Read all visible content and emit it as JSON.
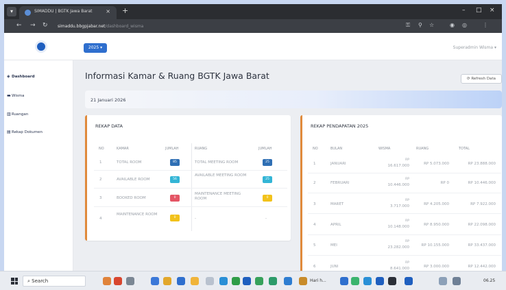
{
  "browser": {
    "tab_title": "SIMADDU | BGTK Jawa Barat",
    "tab_close": "×",
    "new_tab": "+",
    "url_host": "simaddu.bbgpjabar.net",
    "url_path": "/dashboard_wisma",
    "window_minimize": "–",
    "window_maximize": "□",
    "window_close": "×"
  },
  "header": {
    "year_button": "2025 ▾",
    "user_menu": "Superadmin Wisma ▾"
  },
  "sidebar": {
    "items": [
      {
        "label": "Dashboard",
        "icon": "dashboard-icon"
      },
      {
        "label": "Wisma",
        "icon": "bed-icon"
      },
      {
        "label": "Ruangan",
        "icon": "building-icon"
      },
      {
        "label": "Rekap Dokumen",
        "icon": "document-icon"
      }
    ]
  },
  "main": {
    "title": "Informasi Kamar & Ruang BGTK Jawa Barat",
    "refresh_label": "Refresh Data",
    "date": "21 Januari 2026"
  },
  "rekap_data": {
    "title": "REKAP DATA",
    "headers": {
      "no": "NO",
      "kamar": "KAMAR",
      "jumlah": "JUMLAH",
      "ruang": "RUANG",
      "jumlah2": "JUMLAH"
    },
    "rows": [
      {
        "no": "1",
        "kamar": "TOTAL ROOM",
        "kamar_count": "85",
        "kamar_color": "#2f6fb4",
        "ruang": "TOTAL MEETING ROOM",
        "ruang_count": "25",
        "ruang_color": "#2f6fb4"
      },
      {
        "no": "2",
        "kamar": "AVAILABLE ROOM",
        "kamar_count": "56",
        "kamar_color": "#33b5d6",
        "ruang": "AVAILABLE MEETING ROOM",
        "ruang_count": "25",
        "ruang_color": "#33b5d6"
      },
      {
        "no": "3",
        "kamar": "BOOKED ROOM",
        "kamar_count": "0",
        "kamar_color": "#e45565",
        "ruang": "MAINTENANCE MEETING ROOM",
        "ruang_count": "0",
        "ruang_color": "#f2c21b"
      },
      {
        "no": "4",
        "kamar": "MAINTENANCE ROOM",
        "kamar_count": "0",
        "kamar_color": "#f2c21b",
        "ruang": "-",
        "ruang_count": "-",
        "ruang_color": ""
      }
    ]
  },
  "rekap_pendapatan": {
    "title": "REKAP PENDAPATAN 2025",
    "headers": {
      "no": "NO",
      "bulan": "BULAN",
      "wisma": "WISMA",
      "ruang": "RUANG",
      "total": "TOTAL"
    },
    "rows": [
      {
        "no": "1",
        "bulan": "JANUARI",
        "wisma_rp": "RP",
        "wisma": "16.617.000",
        "ruang": "RP 5.073.000",
        "total": "RP 23.888.000"
      },
      {
        "no": "2",
        "bulan": "FEBRUARI",
        "wisma_rp": "RP",
        "wisma": "10.446.000",
        "ruang": "RP 0",
        "total": "RP 10.446.000"
      },
      {
        "no": "3",
        "bulan": "MARET",
        "wisma_rp": "RP",
        "wisma": "3.717.000",
        "ruang": "RP 4.205.000",
        "total": "RP 7.922.000"
      },
      {
        "no": "4",
        "bulan": "APRIL",
        "wisma_rp": "RP",
        "wisma": "10.148.000",
        "ruang": "RP 8.950.000",
        "total": "RP 22.098.000"
      },
      {
        "no": "5",
        "bulan": "MEI",
        "wisma_rp": "RP",
        "wisma": "23.282.000",
        "ruang": "RP 10.155.000",
        "total": "RP 33.437.000"
      },
      {
        "no": "6",
        "bulan": "JUNI",
        "wisma_rp": "RP",
        "wisma": "8.641.000",
        "ruang": "RP 3.000.000",
        "total": "RP 12.442.000"
      }
    ]
  },
  "taskbar": {
    "search_label": "Search",
    "pinned_text": "Hari h...",
    "clock": "06.25"
  }
}
